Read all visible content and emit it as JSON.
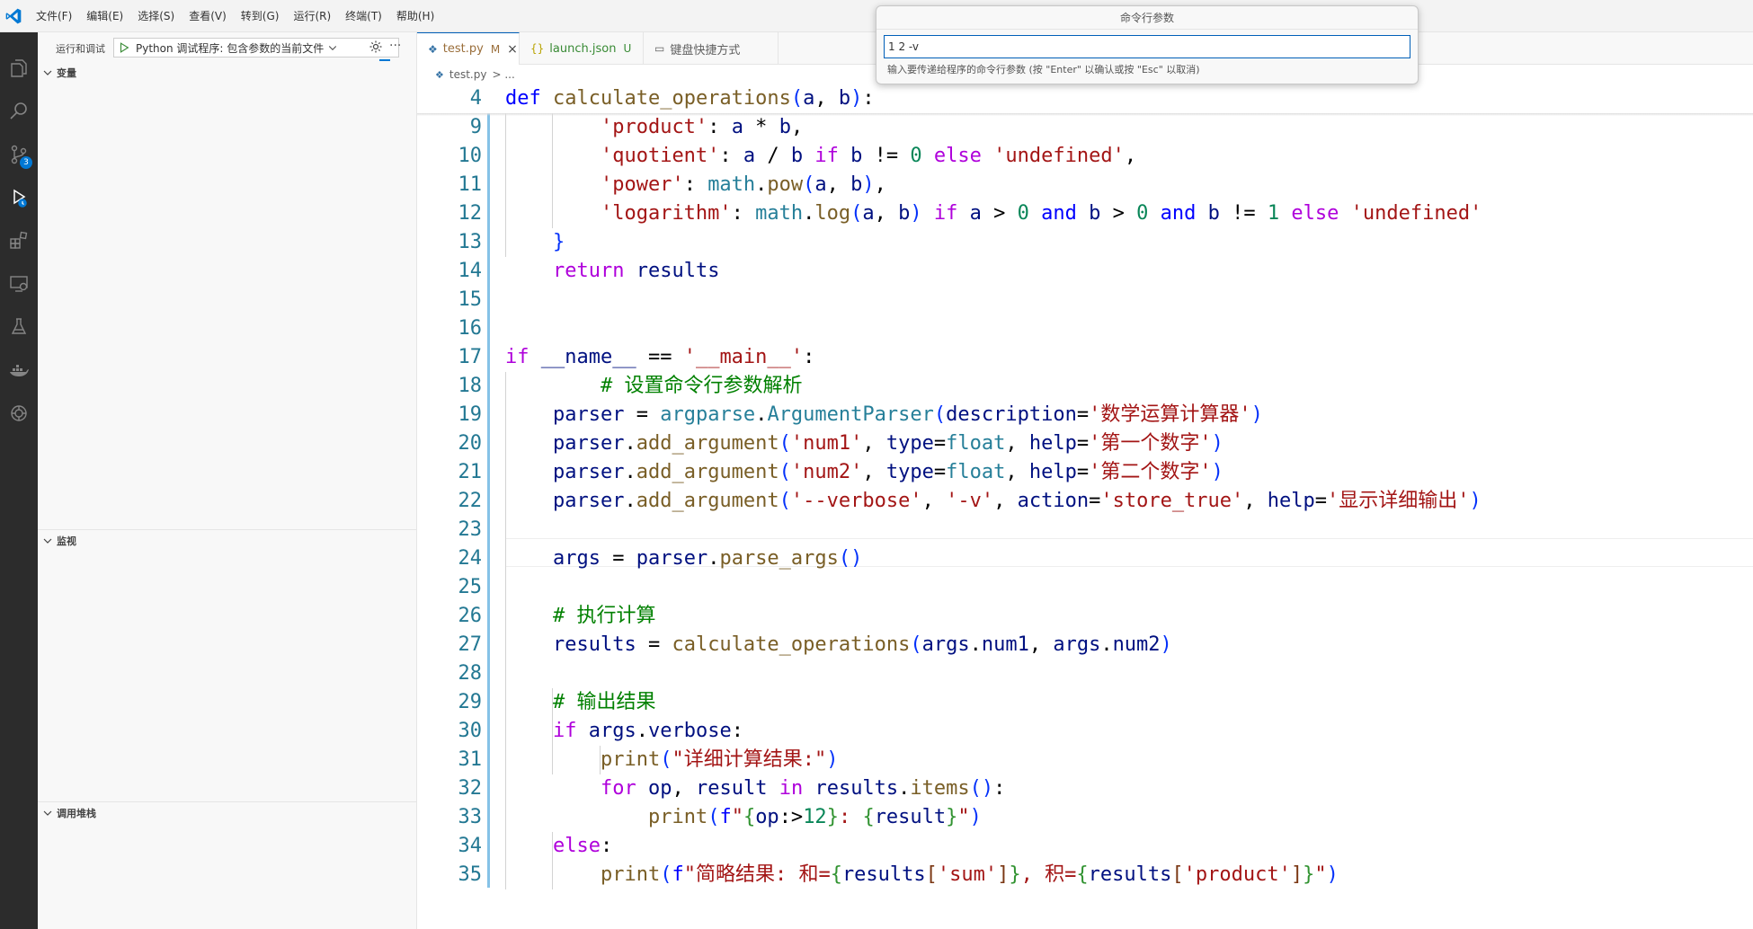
{
  "titlebar": {
    "menu": [
      "文件(F)",
      "编辑(E)",
      "选择(S)",
      "查看(V)",
      "转到(G)",
      "运行(R)",
      "终端(T)",
      "帮助(H)"
    ]
  },
  "activitybar": {
    "icons": [
      "explorer-icon",
      "search-icon",
      "source-control-icon",
      "run-debug-icon",
      "extensions-icon",
      "remote-explorer-icon",
      "testing-icon",
      "docker-icon",
      "remote-icon"
    ],
    "source_control_badge": "3"
  },
  "sidebar": {
    "title": "运行和调试",
    "launch_config": "Python 调试程序: 包含参数的当前文件",
    "sections": {
      "variables": "变量",
      "watch": "监视",
      "callstack": "调用堆栈"
    }
  },
  "tabs": [
    {
      "label": "test.py",
      "status": "M",
      "icon": "python-file-icon",
      "active": true
    },
    {
      "label": "launch.json",
      "status": "U",
      "icon": "json-file-icon",
      "active": false
    },
    {
      "label": "键盘快捷方式",
      "status": "",
      "icon": "keyboard-icon",
      "active": false
    }
  ],
  "breadcrumb": {
    "file": "test.py",
    "sep": "> ..."
  },
  "quick_input": {
    "title": "命令行参数",
    "value": "1 2 -v",
    "prompt": "输入要传递给程序的命令行参数 (按 \"Enter\" 以确认或按 \"Esc\" 以取消)"
  },
  "colors": {
    "accent": "#005fb8",
    "activity_bg": "#2c2c2c",
    "badge": "#0078d4"
  },
  "editor": {
    "lines": [
      {
        "n": "4",
        "tokens": [
          [
            "kw",
            "def"
          ],
          [
            "pl",
            " "
          ],
          [
            "fn",
            "calculate_operations"
          ],
          [
            "br1",
            "("
          ],
          [
            "var",
            "a"
          ],
          [
            "pl",
            ", "
          ],
          [
            "var",
            "b"
          ],
          [
            "br1",
            ")"
          ],
          [
            "pl",
            ":"
          ]
        ]
      },
      {
        "n": "9",
        "tokens": [
          [
            "pl",
            "        "
          ],
          [
            "str",
            "'product'"
          ],
          [
            "pl",
            ": "
          ],
          [
            "var",
            "a"
          ],
          [
            "pl",
            " * "
          ],
          [
            "var",
            "b"
          ],
          [
            "pl",
            ","
          ]
        ]
      },
      {
        "n": "10",
        "tokens": [
          [
            "pl",
            "        "
          ],
          [
            "str",
            "'quotient'"
          ],
          [
            "pl",
            ": "
          ],
          [
            "var",
            "a"
          ],
          [
            "pl",
            " / "
          ],
          [
            "var",
            "b"
          ],
          [
            "pl",
            " "
          ],
          [
            "ctl",
            "if"
          ],
          [
            "pl",
            " "
          ],
          [
            "var",
            "b"
          ],
          [
            "pl",
            " != "
          ],
          [
            "num",
            "0"
          ],
          [
            "pl",
            " "
          ],
          [
            "ctl",
            "else"
          ],
          [
            "pl",
            " "
          ],
          [
            "str",
            "'undefined'"
          ],
          [
            "pl",
            ","
          ]
        ]
      },
      {
        "n": "11",
        "tokens": [
          [
            "pl",
            "        "
          ],
          [
            "str",
            "'power'"
          ],
          [
            "pl",
            ": "
          ],
          [
            "mod",
            "math"
          ],
          [
            "pl",
            "."
          ],
          [
            "fn",
            "pow"
          ],
          [
            "br1",
            "("
          ],
          [
            "var",
            "a"
          ],
          [
            "pl",
            ", "
          ],
          [
            "var",
            "b"
          ],
          [
            "br1",
            ")"
          ],
          [
            "pl",
            ","
          ]
        ]
      },
      {
        "n": "12",
        "tokens": [
          [
            "pl",
            "        "
          ],
          [
            "str",
            "'logarithm'"
          ],
          [
            "pl",
            ": "
          ],
          [
            "mod",
            "math"
          ],
          [
            "pl",
            "."
          ],
          [
            "fn",
            "log"
          ],
          [
            "br1",
            "("
          ],
          [
            "var",
            "a"
          ],
          [
            "pl",
            ", "
          ],
          [
            "var",
            "b"
          ],
          [
            "br1",
            ")"
          ],
          [
            "pl",
            " "
          ],
          [
            "ctl",
            "if"
          ],
          [
            "pl",
            " "
          ],
          [
            "var",
            "a"
          ],
          [
            "pl",
            " > "
          ],
          [
            "num",
            "0"
          ],
          [
            "pl",
            " "
          ],
          [
            "kw",
            "and"
          ],
          [
            "pl",
            " "
          ],
          [
            "var",
            "b"
          ],
          [
            "pl",
            " > "
          ],
          [
            "num",
            "0"
          ],
          [
            "pl",
            " "
          ],
          [
            "kw",
            "and"
          ],
          [
            "pl",
            " "
          ],
          [
            "var",
            "b"
          ],
          [
            "pl",
            " != "
          ],
          [
            "num",
            "1"
          ],
          [
            "pl",
            " "
          ],
          [
            "ctl",
            "else"
          ],
          [
            "pl",
            " "
          ],
          [
            "str",
            "'undefined'"
          ]
        ]
      },
      {
        "n": "13",
        "tokens": [
          [
            "pl",
            "    "
          ],
          [
            "br1",
            "}"
          ]
        ]
      },
      {
        "n": "14",
        "tokens": [
          [
            "pl",
            "    "
          ],
          [
            "ctl",
            "return"
          ],
          [
            "pl",
            " "
          ],
          [
            "var",
            "results"
          ]
        ]
      },
      {
        "n": "15",
        "tokens": []
      },
      {
        "n": "16",
        "tokens": []
      },
      {
        "n": "17",
        "tokens": [
          [
            "ctl",
            "if"
          ],
          [
            "pl",
            " "
          ],
          [
            "var",
            "__name__"
          ],
          [
            "pl",
            " == "
          ],
          [
            "str",
            "'__main__'"
          ],
          [
            "pl",
            ":"
          ]
        ]
      },
      {
        "n": "18",
        "tokens": [
          [
            "pl",
            "        "
          ],
          [
            "com",
            "# 设置命令行参数解析"
          ]
        ]
      },
      {
        "n": "19",
        "tokens": [
          [
            "pl",
            "    "
          ],
          [
            "var",
            "parser"
          ],
          [
            "pl",
            " = "
          ],
          [
            "mod",
            "argparse"
          ],
          [
            "pl",
            "."
          ],
          [
            "mod",
            "ArgumentParser"
          ],
          [
            "br1",
            "("
          ],
          [
            "var",
            "description"
          ],
          [
            "pl",
            "="
          ],
          [
            "str",
            "'数学运算计算器'"
          ],
          [
            "br1",
            ")"
          ]
        ]
      },
      {
        "n": "20",
        "tokens": [
          [
            "pl",
            "    "
          ],
          [
            "var",
            "parser"
          ],
          [
            "pl",
            "."
          ],
          [
            "fn",
            "add_argument"
          ],
          [
            "br1",
            "("
          ],
          [
            "str",
            "'num1'"
          ],
          [
            "pl",
            ", "
          ],
          [
            "var",
            "type"
          ],
          [
            "pl",
            "="
          ],
          [
            "mod",
            "float"
          ],
          [
            "pl",
            ", "
          ],
          [
            "var",
            "help"
          ],
          [
            "pl",
            "="
          ],
          [
            "str",
            "'第一个数字'"
          ],
          [
            "br1",
            ")"
          ]
        ]
      },
      {
        "n": "21",
        "tokens": [
          [
            "pl",
            "    "
          ],
          [
            "var",
            "parser"
          ],
          [
            "pl",
            "."
          ],
          [
            "fn",
            "add_argument"
          ],
          [
            "br1",
            "("
          ],
          [
            "str",
            "'num2'"
          ],
          [
            "pl",
            ", "
          ],
          [
            "var",
            "type"
          ],
          [
            "pl",
            "="
          ],
          [
            "mod",
            "float"
          ],
          [
            "pl",
            ", "
          ],
          [
            "var",
            "help"
          ],
          [
            "pl",
            "="
          ],
          [
            "str",
            "'第二个数字'"
          ],
          [
            "br1",
            ")"
          ]
        ]
      },
      {
        "n": "22",
        "tokens": [
          [
            "pl",
            "    "
          ],
          [
            "var",
            "parser"
          ],
          [
            "pl",
            "."
          ],
          [
            "fn",
            "add_argument"
          ],
          [
            "br1",
            "("
          ],
          [
            "str",
            "'--verbose'"
          ],
          [
            "pl",
            ", "
          ],
          [
            "str",
            "'-v'"
          ],
          [
            "pl",
            ", "
          ],
          [
            "var",
            "action"
          ],
          [
            "pl",
            "="
          ],
          [
            "str",
            "'store_true'"
          ],
          [
            "pl",
            ", "
          ],
          [
            "var",
            "help"
          ],
          [
            "pl",
            "="
          ],
          [
            "str",
            "'显示详细输出'"
          ],
          [
            "br1",
            ")"
          ]
        ]
      },
      {
        "n": "23",
        "tokens": []
      },
      {
        "n": "24",
        "tokens": [
          [
            "pl",
            "    "
          ],
          [
            "var",
            "args"
          ],
          [
            "pl",
            " = "
          ],
          [
            "var",
            "parser"
          ],
          [
            "pl",
            "."
          ],
          [
            "fn",
            "parse_args"
          ],
          [
            "br1",
            "()"
          ]
        ]
      },
      {
        "n": "25",
        "tokens": []
      },
      {
        "n": "26",
        "tokens": [
          [
            "pl",
            "    "
          ],
          [
            "com",
            "# 执行计算"
          ]
        ]
      },
      {
        "n": "27",
        "tokens": [
          [
            "pl",
            "    "
          ],
          [
            "var",
            "results"
          ],
          [
            "pl",
            " = "
          ],
          [
            "fn",
            "calculate_operations"
          ],
          [
            "br1",
            "("
          ],
          [
            "var",
            "args"
          ],
          [
            "pl",
            "."
          ],
          [
            "var",
            "num1"
          ],
          [
            "pl",
            ", "
          ],
          [
            "var",
            "args"
          ],
          [
            "pl",
            "."
          ],
          [
            "var",
            "num2"
          ],
          [
            "br1",
            ")"
          ]
        ]
      },
      {
        "n": "28",
        "tokens": []
      },
      {
        "n": "29",
        "tokens": [
          [
            "pl",
            "    "
          ],
          [
            "com",
            "# 输出结果"
          ]
        ]
      },
      {
        "n": "30",
        "tokens": [
          [
            "pl",
            "    "
          ],
          [
            "ctl",
            "if"
          ],
          [
            "pl",
            " "
          ],
          [
            "var",
            "args"
          ],
          [
            "pl",
            "."
          ],
          [
            "var",
            "verbose"
          ],
          [
            "pl",
            ":"
          ]
        ]
      },
      {
        "n": "31",
        "tokens": [
          [
            "pl",
            "        "
          ],
          [
            "fn",
            "print"
          ],
          [
            "br1",
            "("
          ],
          [
            "str",
            "\"详细计算结果:\""
          ],
          [
            "br1",
            ")"
          ]
        ]
      },
      {
        "n": "32",
        "tokens": [
          [
            "pl",
            "        "
          ],
          [
            "ctl",
            "for"
          ],
          [
            "pl",
            " "
          ],
          [
            "var",
            "op"
          ],
          [
            "pl",
            ", "
          ],
          [
            "var",
            "result"
          ],
          [
            "pl",
            " "
          ],
          [
            "ctl",
            "in"
          ],
          [
            "pl",
            " "
          ],
          [
            "var",
            "results"
          ],
          [
            "pl",
            "."
          ],
          [
            "fn",
            "items"
          ],
          [
            "br1",
            "("
          ],
          [
            "br1",
            ")"
          ],
          [
            "pl",
            ":"
          ]
        ]
      },
      {
        "n": "33",
        "tokens": [
          [
            "pl",
            "            "
          ],
          [
            "fn",
            "print"
          ],
          [
            "br1",
            "("
          ],
          [
            "kw",
            "f"
          ],
          [
            "str",
            "\""
          ],
          [
            "br2",
            "{"
          ],
          [
            "var",
            "op"
          ],
          [
            "pl",
            ":>"
          ],
          [
            "num",
            "12"
          ],
          [
            "br2",
            "}"
          ],
          [
            "str",
            ": "
          ],
          [
            "br2",
            "{"
          ],
          [
            "var",
            "result"
          ],
          [
            "br2",
            "}"
          ],
          [
            "str",
            "\""
          ],
          [
            "br1",
            ")"
          ]
        ]
      },
      {
        "n": "34",
        "tokens": [
          [
            "pl",
            "    "
          ],
          [
            "ctl",
            "else"
          ],
          [
            "pl",
            ":"
          ]
        ]
      },
      {
        "n": "35",
        "tokens": [
          [
            "pl",
            "        "
          ],
          [
            "fn",
            "print"
          ],
          [
            "br1",
            "("
          ],
          [
            "kw",
            "f"
          ],
          [
            "str",
            "\"简略结果: 和="
          ],
          [
            "br2",
            "{"
          ],
          [
            "var",
            "results"
          ],
          [
            "br3",
            "["
          ],
          [
            "str",
            "'sum'"
          ],
          [
            "br3",
            "]"
          ],
          [
            "br2",
            "}"
          ],
          [
            "str",
            ", 积="
          ],
          [
            "br2",
            "{"
          ],
          [
            "var",
            "results"
          ],
          [
            "br3",
            "["
          ],
          [
            "str",
            "'product'"
          ],
          [
            "br3",
            "]"
          ],
          [
            "br2",
            "}"
          ],
          [
            "str",
            "\""
          ],
          [
            "br1",
            ")"
          ]
        ]
      }
    ]
  }
}
